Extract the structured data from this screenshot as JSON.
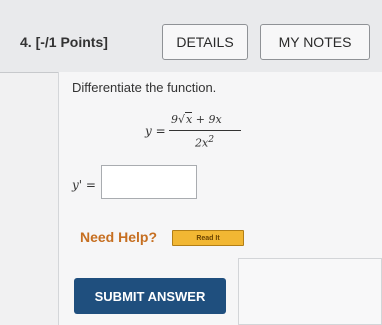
{
  "question": {
    "number": "4.",
    "points": "[-/1 Points]",
    "details_label": "DETAILS",
    "notes_label": "MY NOTES",
    "prompt": "Differentiate the function.",
    "formula": {
      "lhs": "y =",
      "num_coef": "9",
      "num_rad": "x",
      "num_rest": " + 9x",
      "den_base": "2x",
      "den_exp": "2"
    },
    "answer_label": "y' =",
    "answer_value": ""
  },
  "help": {
    "label": "Need Help?",
    "read_label": "Read It"
  },
  "submit_label": "SUBMIT ANSWER",
  "colors": {
    "header_bg": "#e9eaec",
    "help_orange": "#c66f21",
    "read_button": "#f2b733",
    "submit_blue": "#1f4f7e"
  }
}
